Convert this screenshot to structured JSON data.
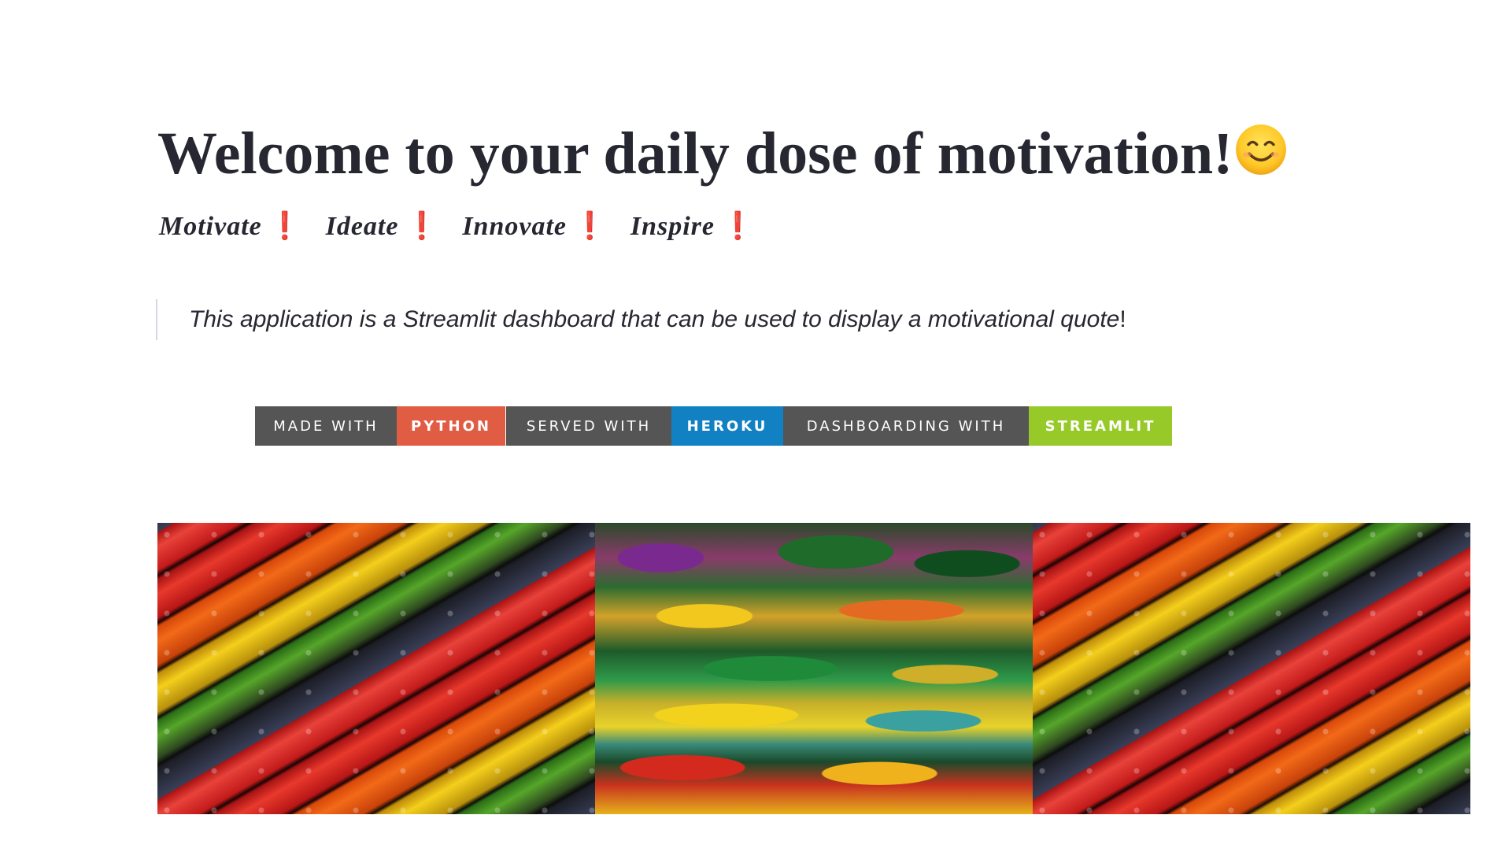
{
  "header": {
    "title": "Welcome to your daily dose of motivation!",
    "title_icon": "smiling-face-emoji"
  },
  "tagline": {
    "items": [
      "Motivate",
      "Ideate",
      "Innovate",
      "Inspire"
    ],
    "bang": "❗"
  },
  "description": {
    "text": "This application is a Streamlit dashboard that can be used to display a motivational quote",
    "end": "!"
  },
  "badges": [
    {
      "label": "MADE WITH",
      "value": "PYTHON",
      "color": "#E05D44"
    },
    {
      "label": "SERVED WITH",
      "value": "HEROKU",
      "color": "#1281C4"
    },
    {
      "label": "DASHBOARDING WITH",
      "value": "STREAMLIT",
      "color": "#97CA29"
    }
  ],
  "banner": {
    "panels": [
      "colored-pencils-image",
      "abstract-painting-image",
      "colored-pencils-image"
    ]
  },
  "colors": {
    "text": "#262730",
    "bang": "#DD1111",
    "badge_label_bg": "#555555"
  }
}
